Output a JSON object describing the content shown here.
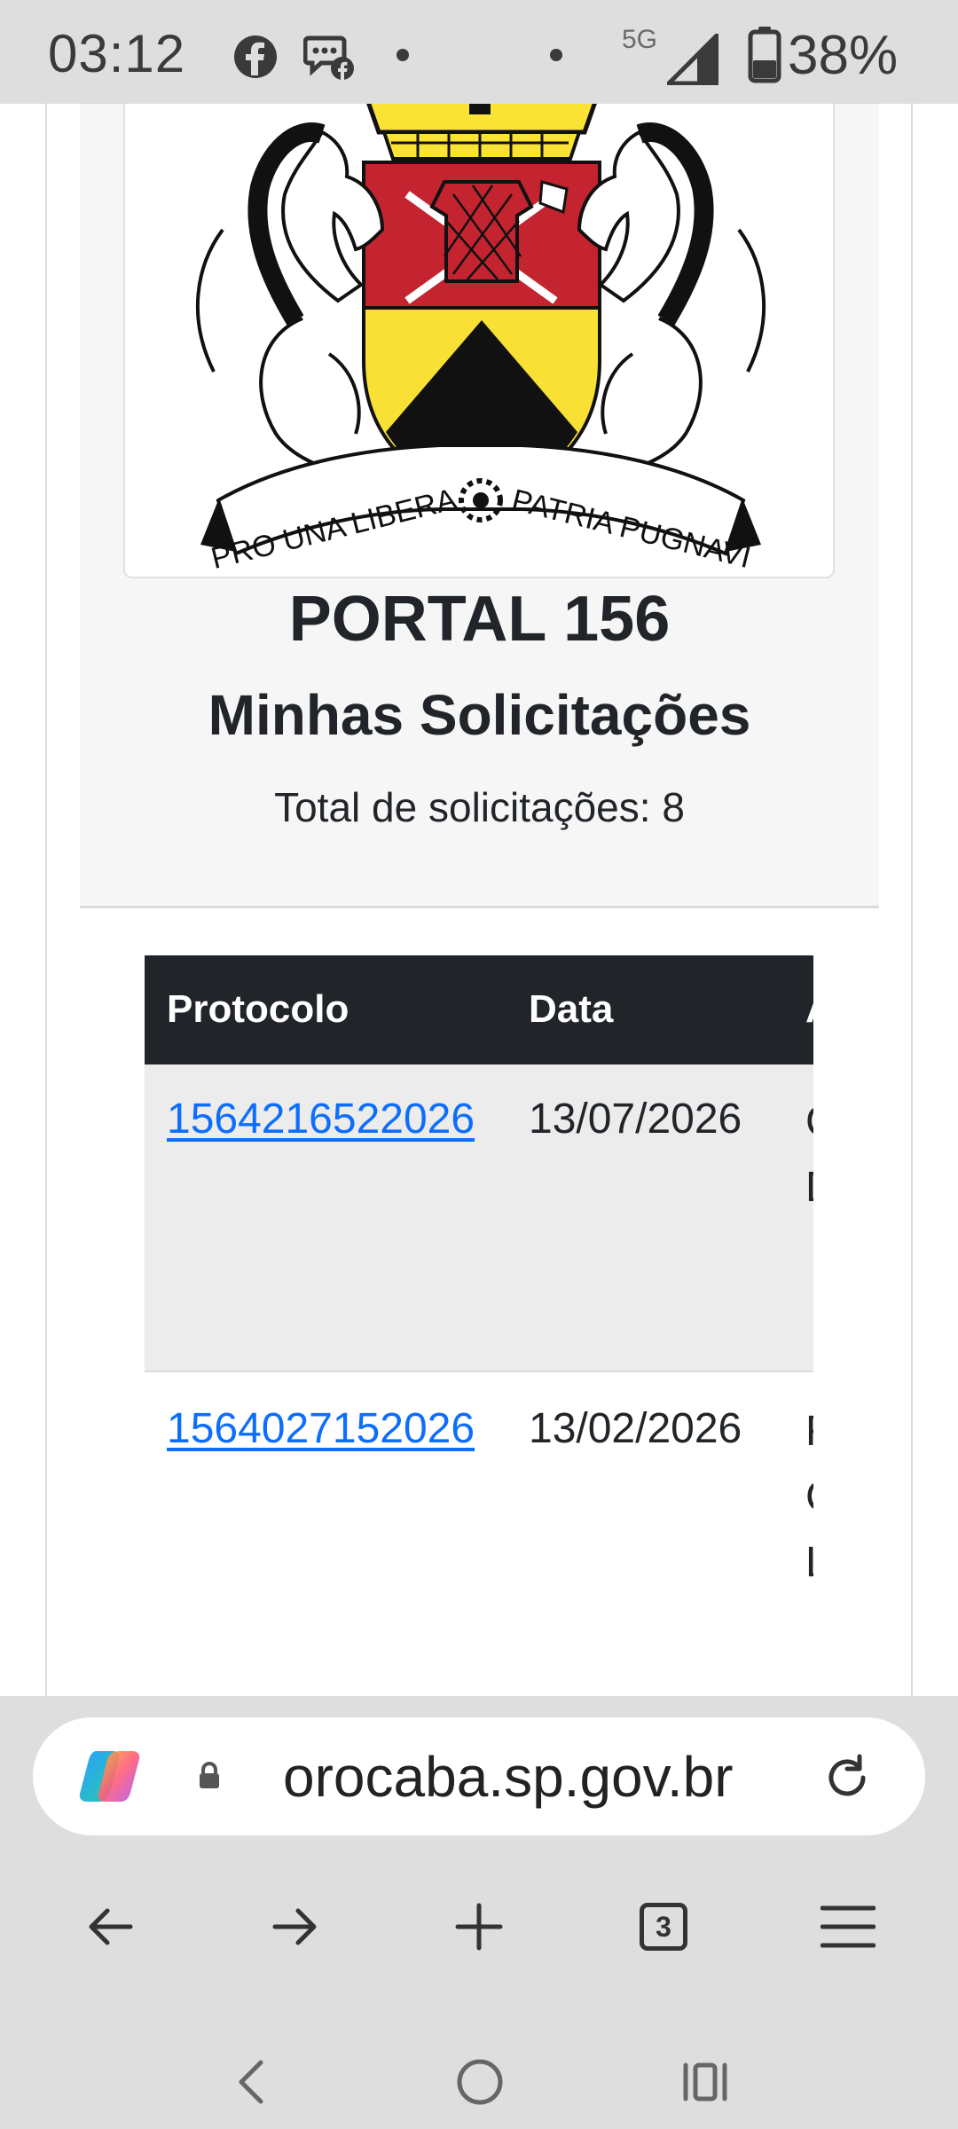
{
  "status_bar": {
    "time": "03:12",
    "network": "5G",
    "battery": "38%",
    "icons": [
      "facebook-icon",
      "messenger-facebook-icon",
      "dot-icon",
      "dot-icon",
      "signal-icon",
      "battery-icon"
    ]
  },
  "crest": {
    "motto_left": "PRO UNA LIBERA",
    "motto_right": "PATRIA PUGNAVI",
    "colors": {
      "red": "#c3242f",
      "yellow": "#f9e034",
      "gold": "#fbe336",
      "black": "#111111"
    }
  },
  "hero": {
    "title": "PORTAL 156",
    "subtitle": "Minhas Solicitações",
    "total": "Total de solicitações: 8"
  },
  "table": {
    "headers": {
      "protocolo": "Protocolo",
      "data": "Data"
    },
    "rows": [
      {
        "protocolo": "1564216522026",
        "data": "13/07/2026"
      },
      {
        "protocolo": "1564027152026",
        "data": "13/02/2026"
      }
    ],
    "colors": {
      "header_bg": "#212529",
      "link": "#0d6efd",
      "row_stripe": "#ececec"
    }
  },
  "browser": {
    "url": "orocaba.sp.gov.br",
    "tab_count": "3",
    "icons": [
      "copilot-icon",
      "lock-icon",
      "reload-icon",
      "back-icon",
      "forward-icon",
      "new-tab-icon",
      "tabs-icon",
      "menu-icon"
    ]
  },
  "nav_bar": {
    "icons": [
      "nav-back-icon",
      "nav-home-icon",
      "nav-recents-icon"
    ]
  }
}
